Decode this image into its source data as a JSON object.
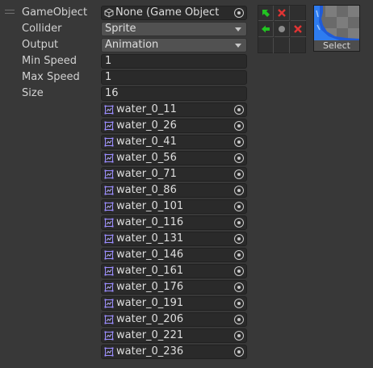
{
  "fields": {
    "gameobject": {
      "label": "GameObject",
      "value": "None (Game Object"
    },
    "collider": {
      "label": "Collider",
      "value": "Sprite"
    },
    "output": {
      "label": "Output",
      "value": "Animation"
    },
    "min_speed": {
      "label": "Min Speed",
      "value": "1"
    },
    "max_speed": {
      "label": "Max Speed",
      "value": "1"
    },
    "size": {
      "label": "Size",
      "value": "16"
    }
  },
  "sprites": [
    "water_0_11",
    "water_0_26",
    "water_0_41",
    "water_0_56",
    "water_0_71",
    "water_0_86",
    "water_0_101",
    "water_0_116",
    "water_0_131",
    "water_0_146",
    "water_0_161",
    "water_0_176",
    "water_0_191",
    "water_0_206",
    "water_0_221",
    "water_0_236"
  ],
  "tile_rule_grid": {
    "cells": [
      "arrow-up-left-icon",
      "x-icon",
      "empty",
      "arrow-left-icon",
      "center-dot-icon",
      "x-icon",
      "empty",
      "empty",
      "empty"
    ],
    "colors": {
      "arrow": "#22c322",
      "x": "#e03434"
    }
  },
  "preview": {
    "button_label": "Select"
  }
}
